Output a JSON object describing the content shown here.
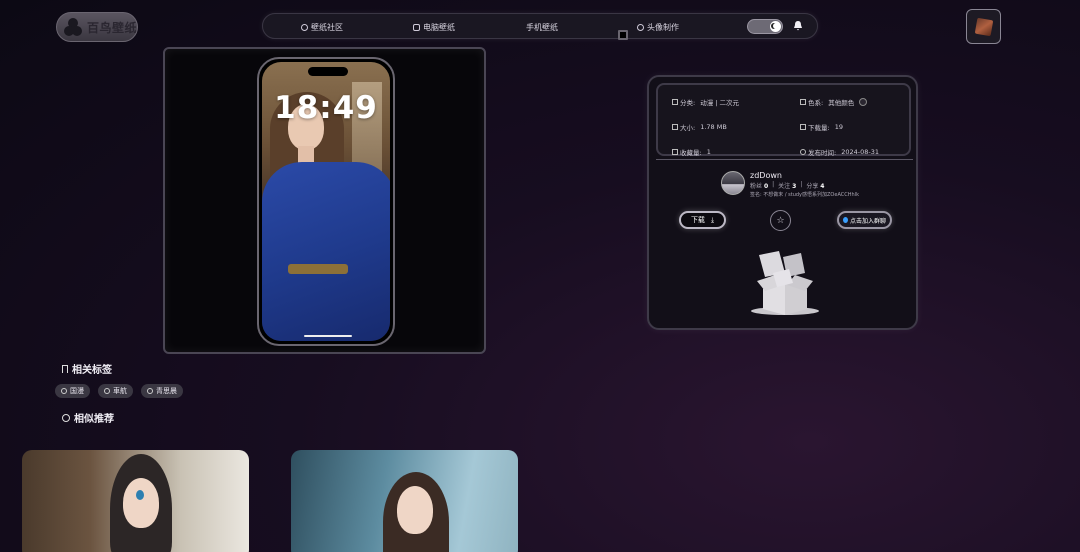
{
  "brand": {
    "logo_text": "百鸟壁纸"
  },
  "nav": {
    "items": [
      {
        "label": "壁纸社区",
        "icon": "community-icon"
      },
      {
        "label": "电脑壁纸",
        "icon": "image-icon"
      },
      {
        "label": "手机壁纸",
        "icon": "phone-icon"
      },
      {
        "label": "头像制作",
        "icon": "smile-icon"
      }
    ],
    "theme_toggle": "dark",
    "notification_icon": "bell-icon"
  },
  "preview": {
    "clock": "18:49"
  },
  "info": {
    "category_label": "分类:",
    "category_value": "动漫 | 二次元",
    "color_label": "色系:",
    "color_value": "其他颜色",
    "size_label": "大小:",
    "size_value": "1.78 MB",
    "downloads_label": "下载量:",
    "downloads_value": "19",
    "favorites_label": "收藏量:",
    "favorites_value": "1",
    "published_label": "发布时间:",
    "published_value": "2024-08-31"
  },
  "user": {
    "name": "zdDown",
    "stats": [
      {
        "label": "粉丝",
        "value": "0"
      },
      {
        "label": "关注",
        "value": "3"
      },
      {
        "label": "分享",
        "value": "4"
      }
    ],
    "signature": "签名: 不想做末 / study感悟系列加ZOeACCHhlk"
  },
  "actions": {
    "download_label": "下载",
    "group_label": "点击加入群聊"
  },
  "sections": {
    "tags_title": "相关标签",
    "recommend_title": "相似推荐"
  },
  "tags": [
    "国漫",
    "車航",
    "青思晨"
  ],
  "colors": {
    "accent": "#3aa0ff",
    "background": "#0c0914"
  }
}
